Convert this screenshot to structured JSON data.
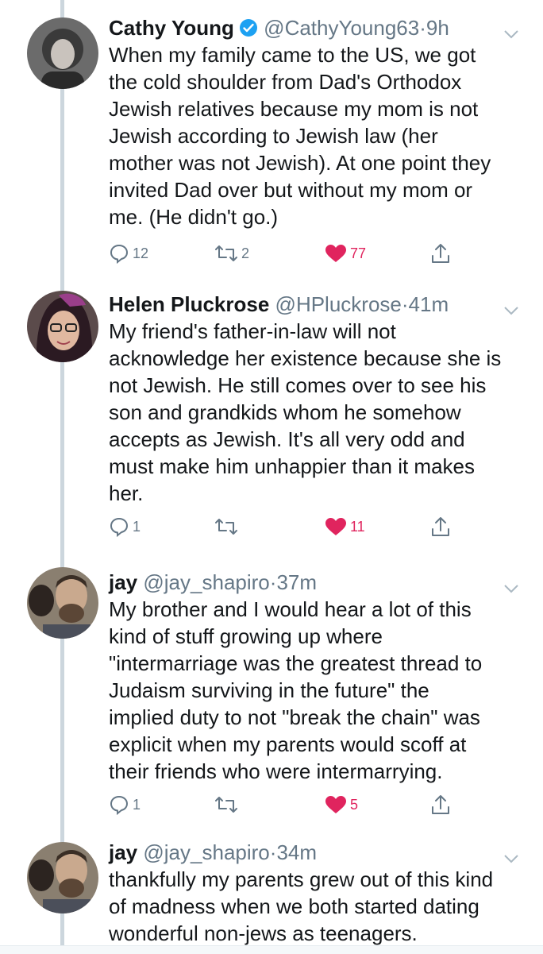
{
  "colors": {
    "accent": "#1da1f2",
    "like": "#e0245e",
    "muted": "#657786",
    "line": "#ccd6dd"
  },
  "tweets": [
    {
      "name": "Cathy Young",
      "verified": true,
      "handle": "@CathyYoung63",
      "dot": "·",
      "time": "9h",
      "lines": [
        "When my family came to the US, we got",
        "the cold shoulder from Dad's Orthodox",
        "Jewish relatives because my mom is not",
        "Jewish according to Jewish law (her",
        "mother was not Jewish). At one point they",
        "invited Dad over but without my mom or",
        "me. (He didn't go.)"
      ],
      "replies": "12",
      "retweets": "2",
      "likes": "77",
      "liked": true
    },
    {
      "name": "Helen Pluckrose",
      "verified": false,
      "handle": "@HPluckrose",
      "dot": "·",
      "time": "41m",
      "lines": [
        "My friend's father-in-law will not",
        "acknowledge her existence because she is",
        "not Jewish. He still comes over to see his",
        "son and grandkids whom he somehow",
        "accepts as Jewish. It's all very odd and",
        "must make him unhappier than it makes",
        "her."
      ],
      "replies": "1",
      "retweets": "",
      "likes": "11",
      "liked": true
    },
    {
      "name": "jay",
      "verified": false,
      "handle": "@jay_shapiro",
      "dot": "·",
      "time": "37m",
      "lines": [
        "My brother and I would hear a lot of this",
        "kind of stuff growing up where",
        "\"intermarriage was the greatest thread to",
        "Judaism surviving in the future\" the",
        "implied duty to not \"break the chain\" was",
        "explicit when my parents would scoff at",
        "their friends who were intermarrying."
      ],
      "replies": "1",
      "retweets": "",
      "likes": "5",
      "liked": true
    },
    {
      "name": "jay",
      "verified": false,
      "handle": "@jay_shapiro",
      "dot": "·",
      "time": "34m",
      "lines": [
        "thankfully my parents grew out of this kind",
        "of madness when we both started dating",
        "wonderful non-jews as teenagers."
      ]
    }
  ]
}
